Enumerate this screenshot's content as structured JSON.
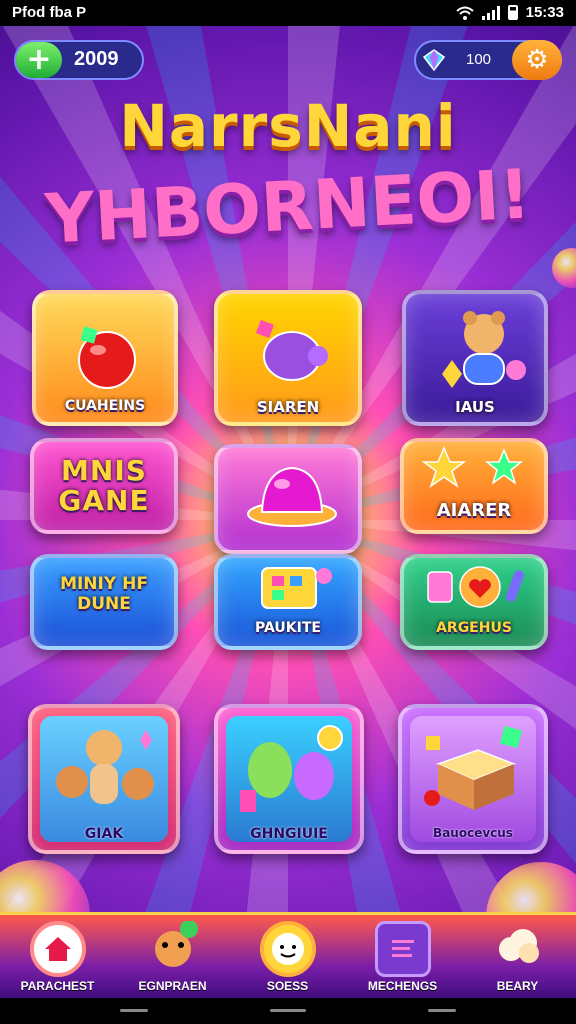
{
  "status_bar": {
    "left_text": "Pfod fba P",
    "time": "15:33"
  },
  "currency": {
    "coins": "2009",
    "gems": "100"
  },
  "title": {
    "line1": "NarrsNani",
    "line2": "YHBORNEOI!"
  },
  "tiles": [
    {
      "label": "CUAHEINS"
    },
    {
      "label": "SIAREN"
    },
    {
      "label": "IAUS"
    },
    {
      "label": "MNIS GANE"
    },
    {
      "label": ""
    },
    {
      "label": "AIARER"
    },
    {
      "label": "MINIY HF DUNE"
    },
    {
      "label": "PAUKITE"
    },
    {
      "label": "ARGEHUS"
    },
    {
      "label": "GIAK"
    },
    {
      "label": "GHNGIUIE"
    },
    {
      "label": "Bauocevcus"
    }
  ],
  "nav": [
    {
      "label": "PARACHEST",
      "icon": "home-icon"
    },
    {
      "label": "EGNPRAEN",
      "icon": "pet-icon"
    },
    {
      "label": "SOESS",
      "icon": "face-icon"
    },
    {
      "label": "MECHENGS",
      "icon": "notes-icon"
    },
    {
      "label": "BEARY",
      "icon": "cloud-icon"
    }
  ],
  "colors": {
    "accent": "#ffd63a",
    "coin_button": "#1eae35",
    "settings_button": "#f07a10"
  }
}
